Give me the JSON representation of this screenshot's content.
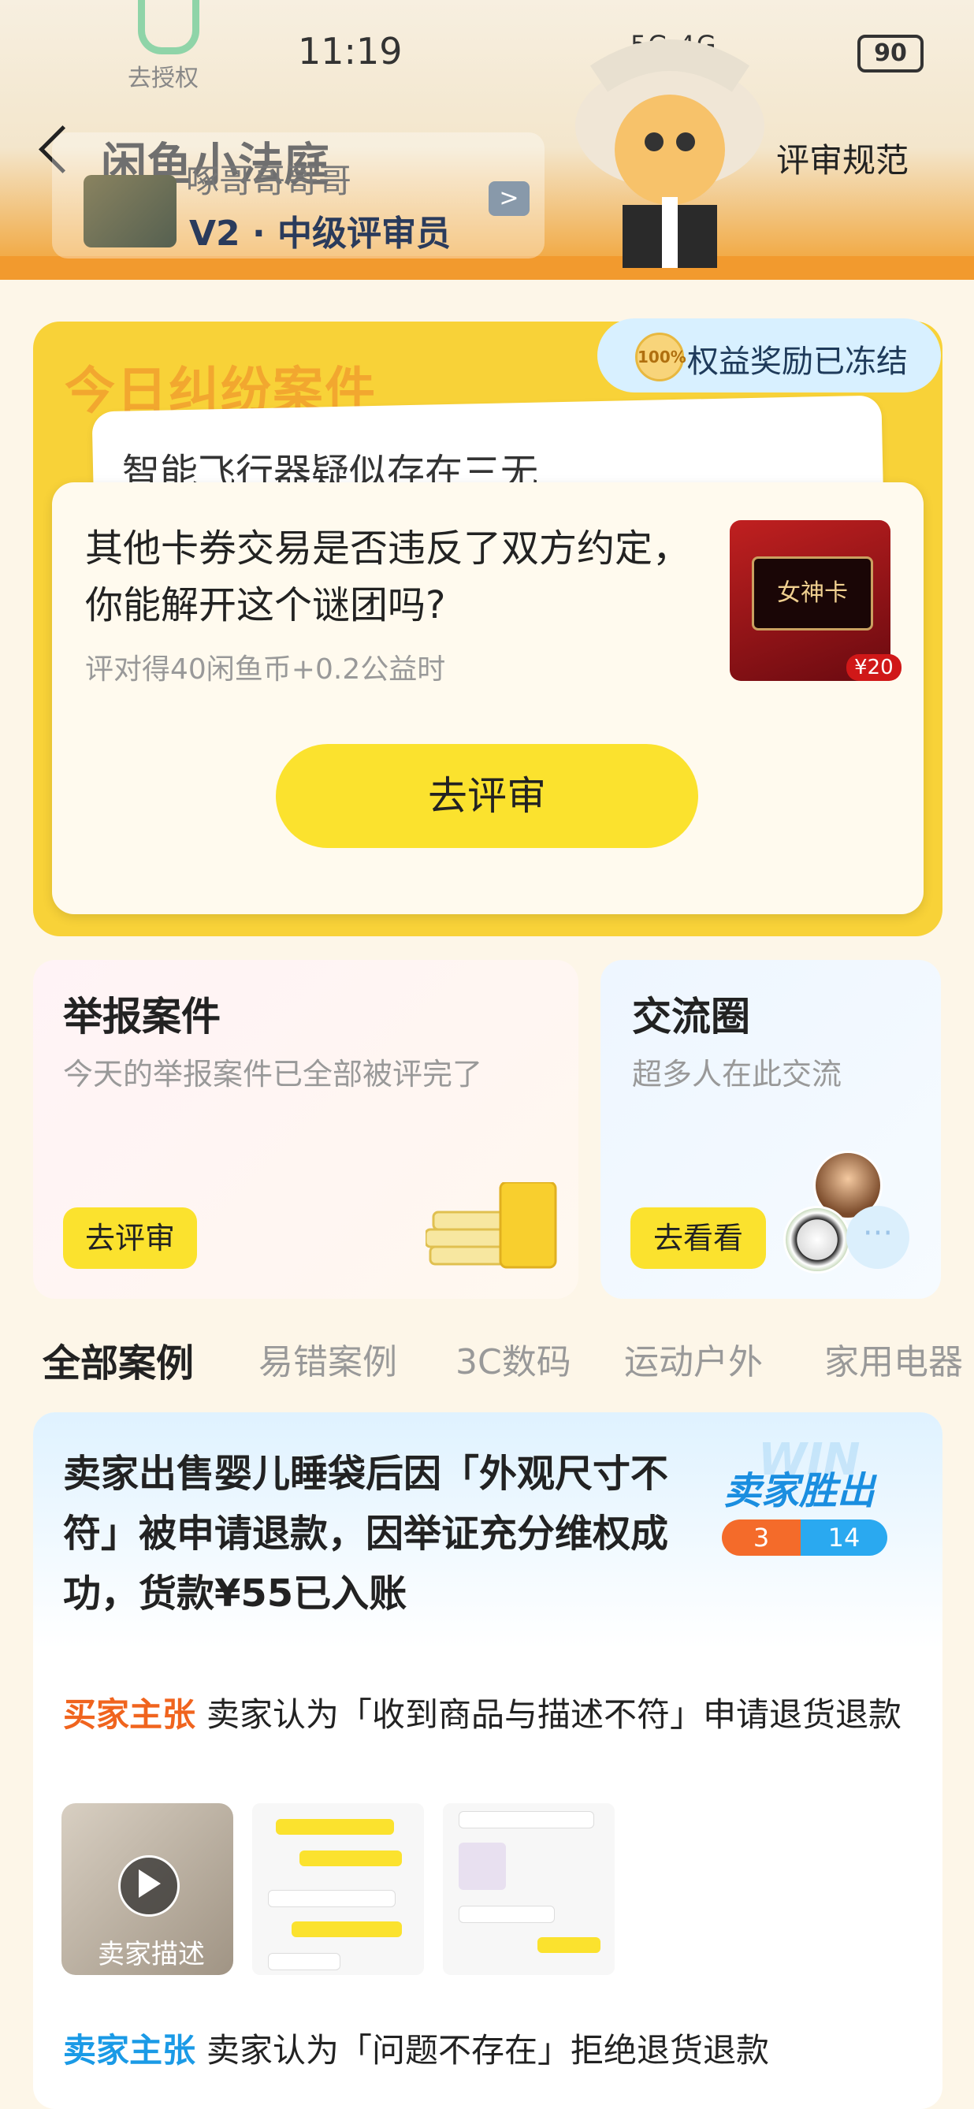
{
  "status_bar": {
    "time": "11:19",
    "network": "5G 4G",
    "battery": "90",
    "auth_label": "去授权"
  },
  "header": {
    "title": "闲鱼小法庭",
    "rules_link": "评审规范",
    "user_name": "啄哥哥哥哥",
    "level_badge": "V2 · 中级评审员",
    "arrow": ">"
  },
  "dispute_panel": {
    "title": "今日纠纷案件",
    "frozen_badge": "权益奖励已冻结",
    "frozen_icon_text": "100%",
    "back_card_text": "智能飞行器疑似存在三无",
    "case_question": "其他卡券交易是否违反了双方约定，你能解开这个谜团吗?",
    "case_reward": "评对得40闲鱼币+0.2公益时",
    "case_image_label": "女神卡",
    "case_image_price": "¥20",
    "review_button": "去评审"
  },
  "report_card": {
    "title": "举报案件",
    "subtitle": "今天的举报案件已全部被评完了",
    "button": "去评审"
  },
  "community_card": {
    "title": "交流圈",
    "subtitle": "超多人在此交流",
    "button": "去看看",
    "more": "···"
  },
  "tabs": [
    {
      "label": "全部案例",
      "active": true
    },
    {
      "label": "易错案例",
      "active": false
    },
    {
      "label": "3C数码",
      "active": false
    },
    {
      "label": "运动户外",
      "active": false
    },
    {
      "label": "家用电器",
      "active": false
    }
  ],
  "case_item": {
    "headline": "卖家出售婴儿睡袋后因「外观尺寸不符」被申请退款，因举证充分维权成功，货款¥55已入账",
    "result_label": "卖家胜出",
    "result_watermark": "WIN",
    "score_left": "3",
    "score_right": "14",
    "claims": [
      {
        "tag": "买家主张",
        "tag_color": "#f0641e",
        "text": "卖家认为「收到商品与描述不符」申请退货退款"
      },
      {
        "tag": "卖家主张",
        "tag_color": "#1a9ae6",
        "text": "卖家认为「问题不存在」拒绝退货退款"
      }
    ],
    "video_label": "卖家描述"
  },
  "colors": {
    "accent_yellow": "#fbe22e",
    "panel_yellow": "#f8d238",
    "win_blue": "#1a8ee0",
    "buyer_orange": "#f46b2a"
  }
}
